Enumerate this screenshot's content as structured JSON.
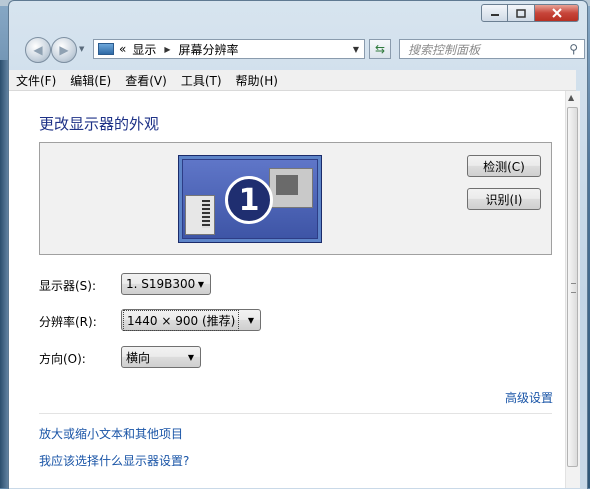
{
  "window": {
    "controls": [
      "minimize-icon",
      "maximize-icon",
      "close-icon"
    ]
  },
  "address": {
    "prefix": "«",
    "crumb1": "显示",
    "crumb2": "屏幕分辨率"
  },
  "search": {
    "placeholder": "搜索控制面板"
  },
  "menu": {
    "file": "文件(F)",
    "edit": "编辑(E)",
    "view": "查看(V)",
    "tools": "工具(T)",
    "help": "帮助(H)"
  },
  "page": {
    "title": "更改显示器的外观",
    "monitor_number": "1",
    "detect_label": "检测(C)",
    "identify_label": "识别(I)",
    "display_label": "显示器(S):",
    "display_value": "1. S19B300",
    "resolution_label": "分辨率(R):",
    "resolution_value": "1440 × 900 (推荐)",
    "orientation_label": "方向(O):",
    "orientation_value": "横向",
    "advanced_link": "高级设置",
    "link_text_size": "放大或缩小文本和其他项目",
    "link_which_settings": "我应该选择什么显示器设置?"
  }
}
